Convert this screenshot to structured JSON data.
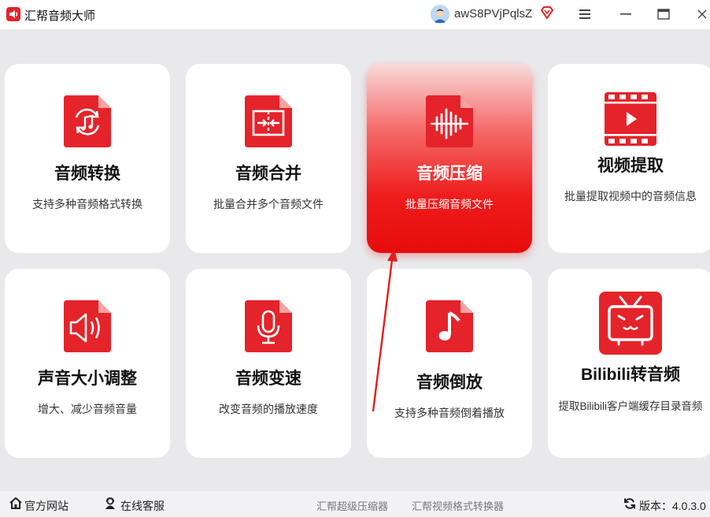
{
  "app": {
    "title": "汇帮音频大师",
    "user_name": "awS8PVjPqlsZ"
  },
  "colors": {
    "accent": "#e5232a",
    "active_card_top": "#f9dada",
    "active_card_bottom": "#e80c0c",
    "background": "#e9e9ec"
  },
  "cards": [
    {
      "title": "音频转换",
      "desc": "支持多种音频格式转换",
      "icon": "audio-convert-icon"
    },
    {
      "title": "音频合并",
      "desc": "批量合并多个音频文件",
      "icon": "audio-merge-icon"
    },
    {
      "title": "音频压缩",
      "desc": "批量压缩音频文件",
      "icon": "audio-compress-icon"
    },
    {
      "title": "视频提取",
      "desc": "批量提取视频中的音频信息",
      "icon": "video-extract-icon"
    },
    {
      "title": "声音大小调整",
      "desc": "增大、减少音频音量",
      "icon": "volume-icon"
    },
    {
      "title": "音频变速",
      "desc": "改变音频的播放速度",
      "icon": "microphone-icon"
    },
    {
      "title": "音频倒放",
      "desc": "支持多种音频倒着播放",
      "icon": "music-note-icon"
    },
    {
      "title": "Bilibili转音频",
      "desc": "提取Bilibili客户端缓存目录音频",
      "icon": "bilibili-tv-icon"
    }
  ],
  "footer": {
    "website": "官方网站",
    "service": "在线客服",
    "link1": "汇帮超级压缩器",
    "link2": "汇帮视频格式转换器",
    "version": "版本：4.0.3.0"
  }
}
